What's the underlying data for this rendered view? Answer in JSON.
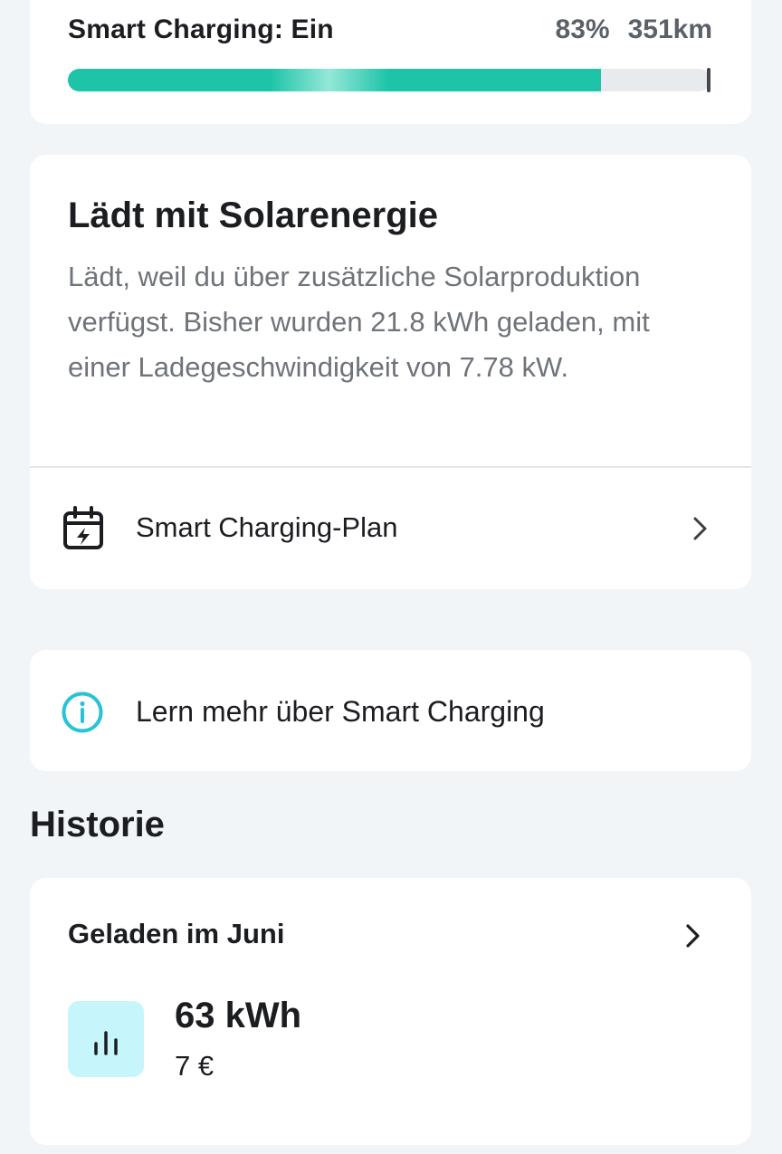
{
  "status": {
    "label": "Smart Charging: Ein",
    "percent_text": "83%",
    "range_text": "351km",
    "battery_level": 0.83,
    "fill_color": "#1fc4a8"
  },
  "solar": {
    "title": "Lädt mit Solarenergie",
    "description": "Lädt, weil du über zusätzliche Solarproduktion verfügst. Bisher wurden 21.8 kWh geladen, mit einer Ladegeschwindigkeit von 7.78 kW.",
    "plan_label": "Smart Charging-Plan",
    "plan_icon": "calendar-bolt-icon"
  },
  "learn": {
    "label": "Lern mehr über Smart Charging",
    "icon": "info-icon",
    "icon_color": "#29c3d6"
  },
  "history": {
    "section_title": "Historie",
    "card_title": "Geladen im Juni",
    "energy": "63 kWh",
    "cost": "7 €",
    "badge_icon": "bar-chart-icon",
    "badge_color": "#c6f6fb"
  }
}
